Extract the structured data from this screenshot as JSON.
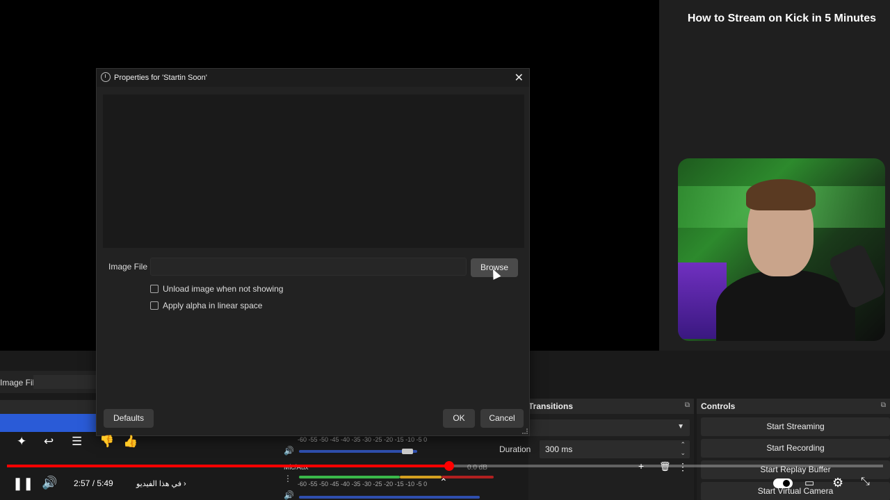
{
  "video": {
    "title": "How to Stream on Kick in 5 Minutes",
    "time": "2:57 / 5:49",
    "chapter": "في هذا الفيديو",
    "progress_fraction": 0.505
  },
  "dialog": {
    "title": "Properties for 'Startin Soon'",
    "image_file_label": "Image File",
    "image_file_value": "",
    "browse_label": "Browse",
    "checkbox_unload": "Unload image when not showing",
    "checkbox_alpha": "Apply alpha in linear space",
    "defaults_label": "Defaults",
    "ok_label": "OK",
    "cancel_label": "Cancel"
  },
  "obs": {
    "image_file_label": "Image File",
    "transitions_title": "Transitions",
    "duration_label": "Duration",
    "duration_value": "300 ms",
    "controls_title": "Controls",
    "controls": [
      "Start Streaming",
      "Start Recording",
      "Start Replay Buffer",
      "Start Virtual Camera"
    ],
    "mixer_ticks": "-60  -55  -50  -45  -40  -35  -30  -25  -20  -15  -10   -5    0",
    "mixer_source": "Mic/Aux",
    "mixer_level": "0.0 dB"
  },
  "colors": {
    "accent": "#2a5bd7",
    "progress": "#ff0000"
  },
  "icons": [
    "info-icon",
    "close-icon",
    "pause-icon",
    "volume-icon",
    "ask-icon",
    "share-icon",
    "comment-icon",
    "dislike-icon",
    "like-icon",
    "settings-icon",
    "captions-icon",
    "fullscreen-exit-icon"
  ]
}
